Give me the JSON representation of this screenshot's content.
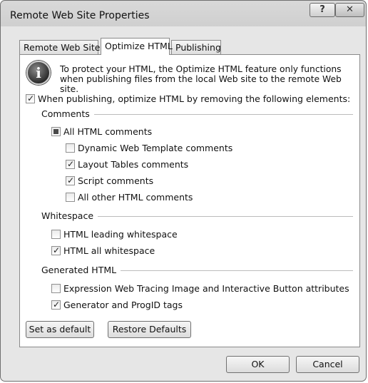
{
  "window": {
    "title": "Remote Web Site Properties",
    "help_glyph": "?",
    "close_glyph": "✕"
  },
  "tabs": [
    {
      "label": "Remote Web Site"
    },
    {
      "label": "Optimize HTML"
    },
    {
      "label": "Publishing"
    }
  ],
  "info": {
    "icon_glyph": "i",
    "text": "To protect your HTML, the Optimize HTML feature only functions when publishing files from the local Web site to the remote Web site."
  },
  "main_option": {
    "label": "When publishing, optimize HTML by removing the following elements:",
    "checked": true
  },
  "comments": {
    "title": "Comments",
    "all": {
      "label": "All HTML comments",
      "state": "indeterminate"
    },
    "items": [
      {
        "label": "Dynamic Web Template comments",
        "checked": false
      },
      {
        "label": "Layout Tables comments",
        "checked": true
      },
      {
        "label": "Script comments",
        "checked": true
      },
      {
        "label": "All other HTML comments",
        "checked": false
      }
    ]
  },
  "whitespace": {
    "title": "Whitespace",
    "items": [
      {
        "label": "HTML leading whitespace",
        "checked": false
      },
      {
        "label": "HTML all whitespace",
        "checked": true
      }
    ]
  },
  "generated": {
    "title": "Generated HTML",
    "items": [
      {
        "label": "Expression Web Tracing Image and Interactive Button attributes",
        "checked": false
      },
      {
        "label": "Generator and ProgID tags",
        "checked": true
      }
    ]
  },
  "buttons": {
    "set_default": "Set as default",
    "restore_defaults": "Restore Defaults",
    "ok": "OK",
    "cancel": "Cancel"
  },
  "check_glyph": "✓"
}
